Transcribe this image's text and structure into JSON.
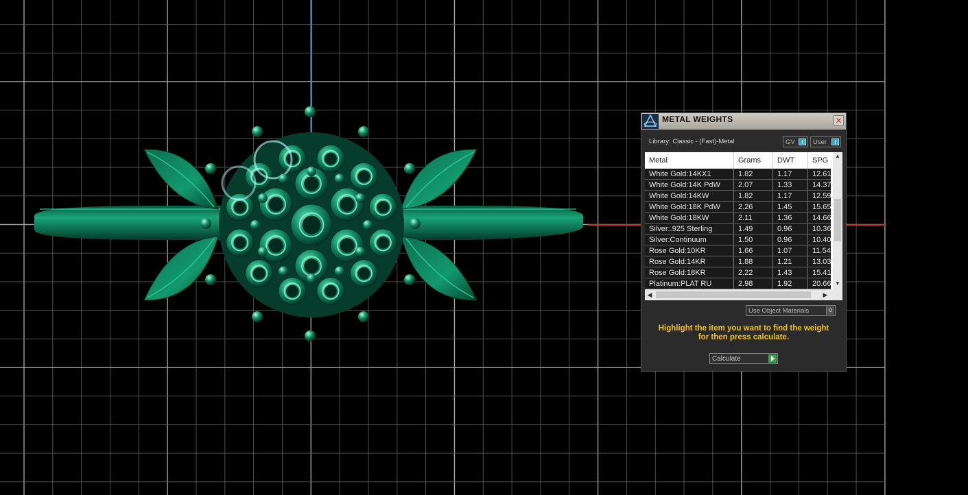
{
  "panel": {
    "title": "METAL WEIGHTS",
    "close_label": "✕",
    "library": "Library: Classic - (Fast)-Metal",
    "gv_label": "GV",
    "user_label": "User",
    "columns": [
      "Metal",
      "Grams",
      "DWT",
      "SPG"
    ],
    "rows": [
      [
        "White Gold:14KX1",
        "1.82",
        "1.17",
        "12.61"
      ],
      [
        "White Gold:14K PdW",
        "2.07",
        "1.33",
        "14.37"
      ],
      [
        "White Gold:14KW",
        "1.82",
        "1.17",
        "12.59"
      ],
      [
        "White Gold:18K PdW",
        "2.26",
        "1.45",
        "15.65"
      ],
      [
        "White Gold:18KW",
        "2.11",
        "1.36",
        "14.66"
      ],
      [
        "Silver:.925 Sterling",
        "1.49",
        "0.96",
        "10.36"
      ],
      [
        "Silver:Continuum",
        "1.50",
        "0.96",
        "10.40"
      ],
      [
        "Rose Gold:10KR",
        "1.66",
        "1.07",
        "11.54"
      ],
      [
        "Rose Gold:14KR",
        "1.88",
        "1.21",
        "13.03"
      ],
      [
        "Rose Gold:18KR",
        "2.22",
        "1.43",
        "15.41"
      ],
      [
        "Platinum:PLAT RU",
        "2.98",
        "1.92",
        "20.66"
      ]
    ],
    "use_object_materials": "Use Object Materials",
    "hint": "Highlight the item you want to find the weight for then press calculate.",
    "calculate_label": "Calculate"
  },
  "colors": {
    "grid": "#8a8a8a",
    "ring_green": "#0f8a63",
    "axis_blue": "#3a8fb0",
    "axis_red": "#c0392b",
    "hint_yellow": "#f0c419"
  }
}
